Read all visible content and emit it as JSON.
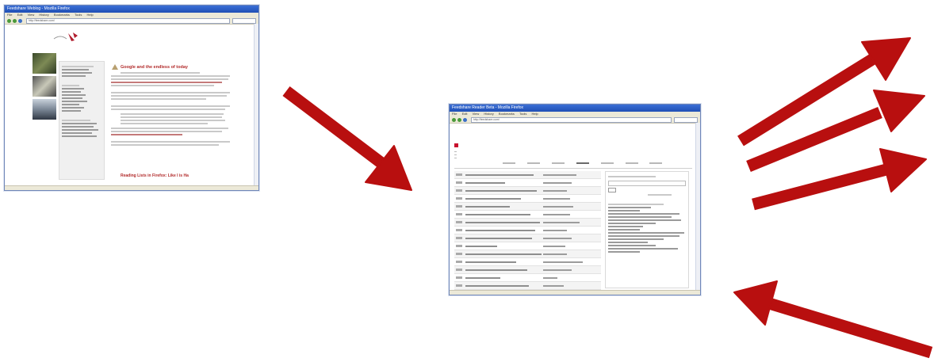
{
  "arrow_color": "#b80f0f",
  "windows": [
    {
      "id": "blog",
      "title": "Feedshare Weblog - Mozilla Firefox",
      "menu": [
        "File",
        "Edit",
        "View",
        "History",
        "Bookmarks",
        "Tools",
        "Help"
      ],
      "address": "http://feedshare.com/",
      "post_title": "Google and the endless of today",
      "post_title_2": "Reading Lists in Firefox: Like I is Ha"
    },
    {
      "id": "reader",
      "title": "Feedshare Reader Beta - Mozilla Firefox",
      "menu": [
        "File",
        "Edit",
        "View",
        "History",
        "Bookmarks",
        "Tools",
        "Help"
      ],
      "address": "http://feedshare.com/"
    }
  ]
}
